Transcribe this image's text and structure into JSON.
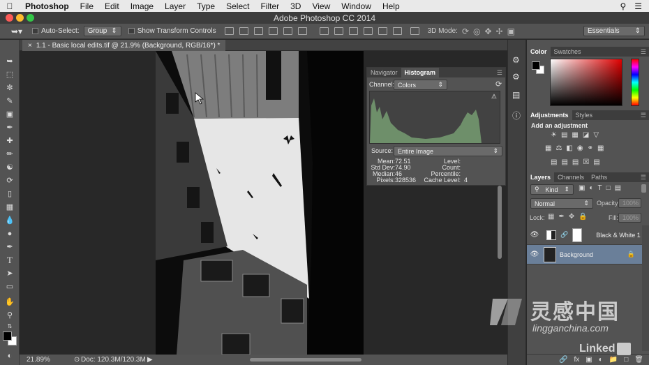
{
  "menubar": {
    "app": "Photoshop",
    "items": [
      "File",
      "Edit",
      "Image",
      "Layer",
      "Type",
      "Select",
      "Filter",
      "3D",
      "View",
      "Window",
      "Help"
    ]
  },
  "window": {
    "title": "Adobe Photoshop CC 2014"
  },
  "options": {
    "auto_select_label": "Auto-Select:",
    "auto_select_value": "Group",
    "transform_label": "Show Transform Controls",
    "mode_label": "3D Mode:",
    "workspace": "Essentials"
  },
  "document": {
    "tab_title": "1.1 - Basic local edits.tif @ 21.9% (Background, RGB/16*) *",
    "zoom": "21.89%",
    "doc_info": "Doc: 120.3M/120.3M"
  },
  "histogram": {
    "tabs": [
      "Navigator",
      "Histogram"
    ],
    "channel_label": "Channel:",
    "channel_value": "Colors",
    "source_label": "Source:",
    "source_value": "Entire Image",
    "stats_left": [
      {
        "label": "Mean:",
        "value": "72.51"
      },
      {
        "label": "Std Dev:",
        "value": "74.90"
      },
      {
        "label": "Median:",
        "value": "46"
      },
      {
        "label": "Pixels:",
        "value": "328536"
      }
    ],
    "stats_right": [
      {
        "label": "Level:",
        "value": ""
      },
      {
        "label": "Count:",
        "value": ""
      },
      {
        "label": "Percentile:",
        "value": ""
      },
      {
        "label": "Cache Level:",
        "value": "4"
      }
    ]
  },
  "color_panel": {
    "tabs": [
      "Color",
      "Swatches"
    ]
  },
  "adjustments_panel": {
    "tabs": [
      "Adjustments",
      "Styles"
    ],
    "heading": "Add an adjustment"
  },
  "layers_panel": {
    "tabs": [
      "Layers",
      "Channels",
      "Paths"
    ],
    "filter_value": "Kind",
    "blend_mode": "Normal",
    "opacity_label": "Opacity:",
    "opacity_value": "100%",
    "lock_label": "Lock:",
    "fill_label": "Fill:",
    "fill_value": "100%",
    "layers": [
      {
        "name": "Black & White 1"
      },
      {
        "name": "Background"
      }
    ]
  },
  "watermark": {
    "brand_cn": "灵感中国",
    "url": "lingganchina.com",
    "linkedin": "Linked"
  },
  "colors": {
    "accent_blue": "#6a7f99",
    "panel": "#535353"
  }
}
